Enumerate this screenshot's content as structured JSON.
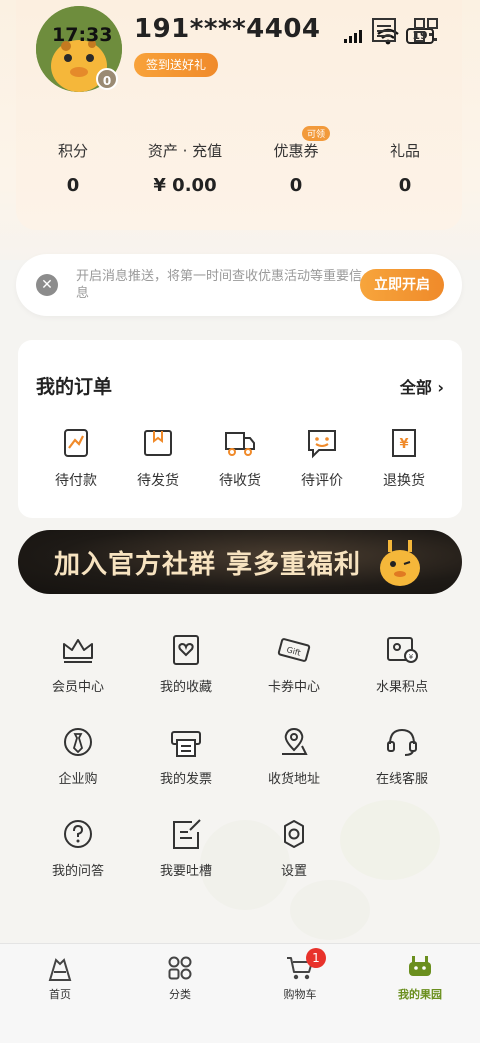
{
  "status_bar": {
    "time": "17:33",
    "battery": "19"
  },
  "profile": {
    "phone": "191****4404",
    "level": "0",
    "signin_label": "签到送好礼"
  },
  "stats": [
    {
      "label": "积分",
      "value": "0"
    },
    {
      "label": "资产 · 充值",
      "value": "¥ 0.00"
    },
    {
      "label": "优惠券",
      "value": "0",
      "tag": "可领"
    },
    {
      "label": "礼品",
      "value": "0"
    }
  ],
  "notification": {
    "text": "开启消息推送，将第一时间查收优惠活动等重要信息",
    "button": "立即开启"
  },
  "orders": {
    "title": "我的订单",
    "all_label": "全部",
    "items": [
      {
        "label": "待付款",
        "icon": "pending-payment-icon"
      },
      {
        "label": "待发货",
        "icon": "pending-shipment-icon"
      },
      {
        "label": "待收货",
        "icon": "pending-receipt-icon"
      },
      {
        "label": "待评价",
        "icon": "pending-review-icon"
      },
      {
        "label": "退换货",
        "icon": "return-exchange-icon"
      }
    ]
  },
  "banner": {
    "text": "加入官方社群 享多重福利"
  },
  "services": [
    {
      "label": "会员中心",
      "icon": "crown-icon"
    },
    {
      "label": "我的收藏",
      "icon": "favorite-icon"
    },
    {
      "label": "卡券中心",
      "icon": "gift-card-icon"
    },
    {
      "label": "水果积点",
      "icon": "points-icon"
    },
    {
      "label": "企业购",
      "icon": "tie-icon"
    },
    {
      "label": "我的发票",
      "icon": "invoice-icon"
    },
    {
      "label": "收货地址",
      "icon": "location-icon"
    },
    {
      "label": "在线客服",
      "icon": "headset-icon"
    },
    {
      "label": "我的问答",
      "icon": "question-icon"
    },
    {
      "label": "我要吐槽",
      "icon": "feedback-icon"
    },
    {
      "label": "设置",
      "icon": "settings-icon"
    }
  ],
  "tabbar": {
    "items": [
      {
        "label": "首页",
        "icon": "home-icon"
      },
      {
        "label": "分类",
        "icon": "category-icon"
      },
      {
        "label": "购物车",
        "icon": "cart-icon",
        "badge": "1"
      },
      {
        "label": "我的果园",
        "icon": "my-orchard-icon",
        "active": true
      }
    ]
  },
  "colors": {
    "accent": "#f08a2a",
    "active_tab": "#6a8f1e",
    "badge": "#e8322b"
  }
}
